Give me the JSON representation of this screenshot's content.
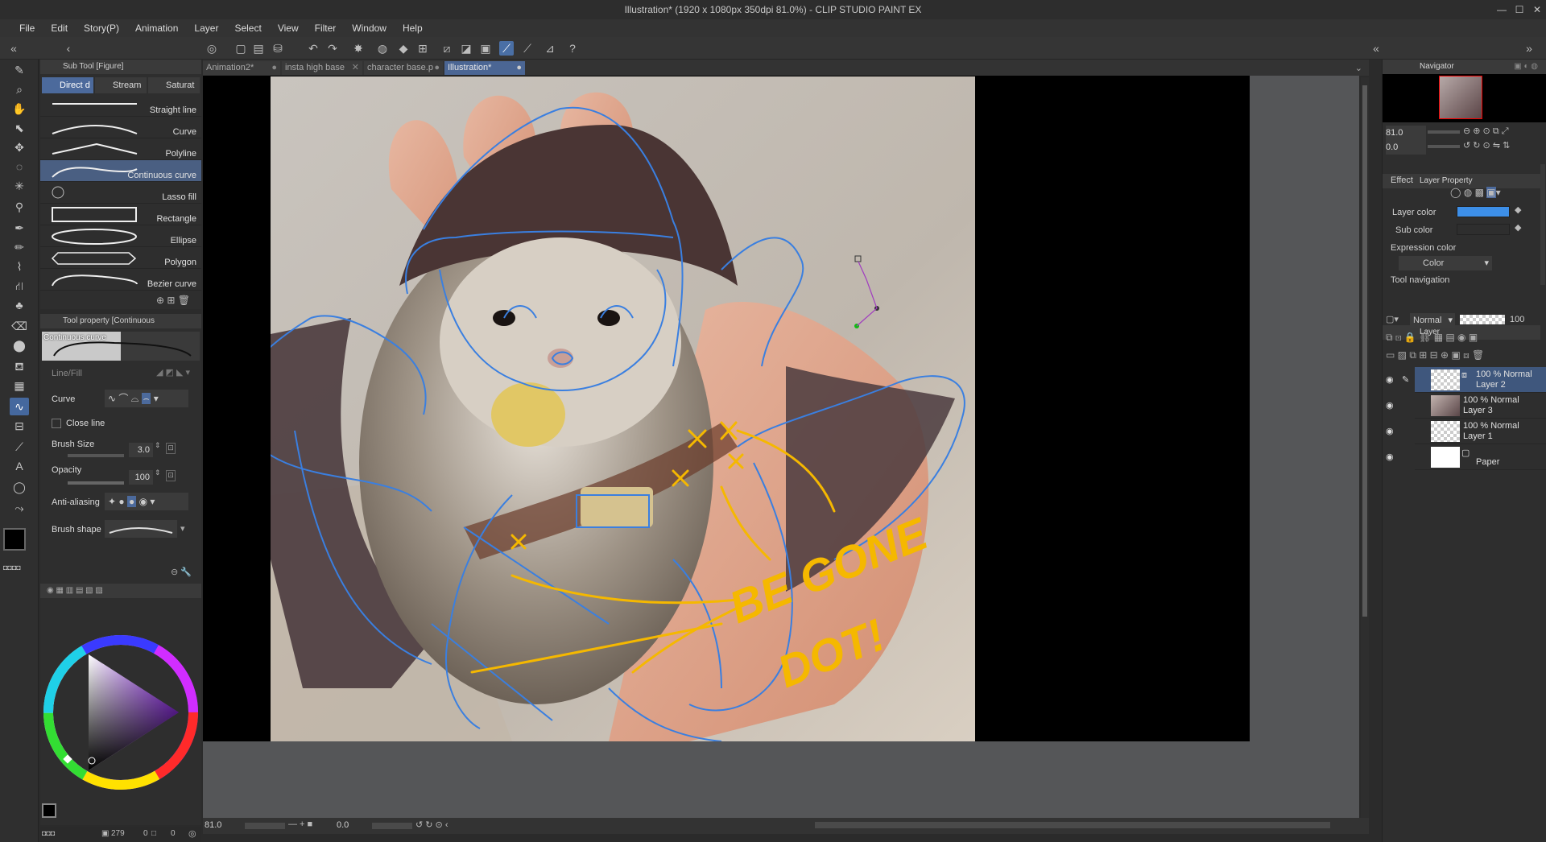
{
  "window": {
    "title": "Illustration* (1920 x 1080px 350dpi 81.0%)  - CLIP STUDIO PAINT EX"
  },
  "menu": [
    "File",
    "Edit",
    "Story(P)",
    "Animation",
    "Layer",
    "Select",
    "View",
    "Filter",
    "Window",
    "Help"
  ],
  "subtool": {
    "title": "Sub Tool [Figure]",
    "tabs": [
      "Direct d",
      "Stream",
      "Saturat"
    ],
    "items": [
      "Straight line",
      "Curve",
      "Polyline",
      "Continuous curve",
      "Lasso fill",
      "Rectangle",
      "Ellipse",
      "Polygon",
      "Bezier curve"
    ],
    "selected_index": 3
  },
  "toolprop": {
    "title": "Tool property [Continuous",
    "preview_label": "Continuous curve",
    "line_fill_label": "Line/Fill",
    "curve_label": "Curve",
    "close_line_label": "Close line",
    "brush_size_label": "Brush Size",
    "brush_size_value": "3.0",
    "opacity_label": "Opacity",
    "opacity_value": "100",
    "antialias_label": "Anti-aliasing",
    "brush_shape_label": "Brush shape"
  },
  "doc_tabs": [
    "Animation2*",
    "insta high base",
    "character base.p",
    "Illustration*"
  ],
  "canvas": {
    "annotation_line1": "BE GONE",
    "annotation_line2": "DOT!"
  },
  "statusbar": {
    "zoom": "81.0",
    "angle": "0.0",
    "left_zoom": "81.0",
    "left_angle": "0.0",
    "memory": "279",
    "count_a": "0",
    "count_b": "0"
  },
  "navigator": {
    "title": "Navigator",
    "zoom": "81.0",
    "angle": "0.0"
  },
  "layer_property": {
    "title": "Layer Property",
    "effect_label": "Effect",
    "layer_color_label": "Layer color",
    "sub_color_label": "Sub color",
    "expression_label": "Expression color",
    "expression_value": "Color",
    "tool_nav_label": "Tool navigation",
    "layer_color": "#3d8fe8",
    "sub_color": "#ffffff"
  },
  "layers": {
    "title": "Layer",
    "blend_mode": "Normal",
    "opacity": "100",
    "items": [
      {
        "opacity": "100 % Normal",
        "name": "Layer 2"
      },
      {
        "opacity": "100 % Normal",
        "name": "Layer 3"
      },
      {
        "opacity": "100 % Normal",
        "name": "Layer 1"
      },
      {
        "opacity": "",
        "name": "Paper"
      }
    ]
  },
  "colors": {
    "main": "#000000",
    "sub": "#7a6440",
    "line": "#3a7fe0",
    "annotation": "#f5b800"
  }
}
